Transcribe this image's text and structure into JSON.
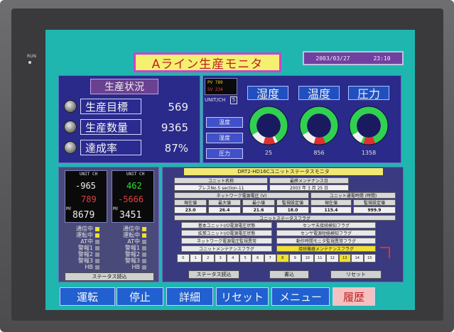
{
  "indicator": {
    "run_label": "RUN"
  },
  "header": {
    "title": "Aライン生産モニタ",
    "date": "2003/03/27",
    "time": "23:10"
  },
  "production": {
    "title": "生産状況",
    "rows": [
      {
        "label": "生産目標",
        "value": "569"
      },
      {
        "label": "生産数量",
        "value": "9365"
      },
      {
        "label": "達成率",
        "value": "87%"
      }
    ]
  },
  "sensor": {
    "mini_pv": "PV 789",
    "mini_sv": "SV 234",
    "unit_label": "UNIT/CH",
    "unit_value": "5",
    "side_buttons": [
      "温度",
      "湿度",
      "圧力"
    ],
    "gauges": [
      {
        "title": "湿度",
        "value": "25",
        "level": 0.75
      },
      {
        "title": "温度",
        "value": "856",
        "level": 0.85
      },
      {
        "title": "圧力",
        "value": "1358",
        "level": 0.9
      }
    ],
    "colors": {
      "gauge_fill": "#30d050",
      "gauge_alarm": "#e03030"
    }
  },
  "devices": [
    {
      "header": "UNIT CH",
      "pv": "-965",
      "sv": "789",
      "mv_label": "MV",
      "mv": "8679"
    },
    {
      "header": "UNIT CH",
      "pv": "462",
      "sv": "-5666",
      "mv_label": "MV",
      "mv": "3451"
    }
  ],
  "device_status": [
    "通信中",
    "運転中",
    "AT中",
    "警報1",
    "警報2",
    "警報3",
    "HB"
  ],
  "device_button": "ステータス読込",
  "unit_monitor": {
    "title": "DRT2-HD16Cユニットステータスモニタ",
    "unit_name_label": "ユニット名称",
    "maint_date_label": "最終メンテナンス日",
    "unit_name": "プレスNo.5 section-11",
    "maint_date": "2003 年 3 月 25 日",
    "voltage_header": "ネットワーク電源電圧 (V)",
    "time_header": "ユニット通電時間 (時間)",
    "cols": [
      "現在値",
      "最大値",
      "最小値",
      "監視設定値",
      "現在値",
      "監視設定値"
    ],
    "vals": [
      "23.0",
      "26.4",
      "21.6",
      "18.0",
      "115.4",
      "999.9"
    ],
    "flags_title": "ユニットステータスフラグ",
    "flags": [
      "基本ユニットI/O電源電圧状態",
      "センサ未接続検知フラグ",
      "拡張ユニットI/O電源電圧状態",
      "センサ電源短絡検知フラグ",
      "ネットワーク電源電圧監視異常",
      "動作時間モニタ監視異常フラグ",
      "ユニットメンテナンスフラグ",
      "接続機器メンテナンスフラグ"
    ],
    "bits": [
      "0",
      "1",
      "2",
      "3",
      "4",
      "5",
      "6",
      "7",
      "8",
      "9",
      "10",
      "11",
      "12",
      "13",
      "14",
      "15"
    ],
    "buttons": [
      "ステータス読込",
      "書込",
      "リセット"
    ]
  },
  "nav": [
    "運転",
    "停止",
    "詳細",
    "リセット",
    "メニュー",
    "履歴"
  ]
}
